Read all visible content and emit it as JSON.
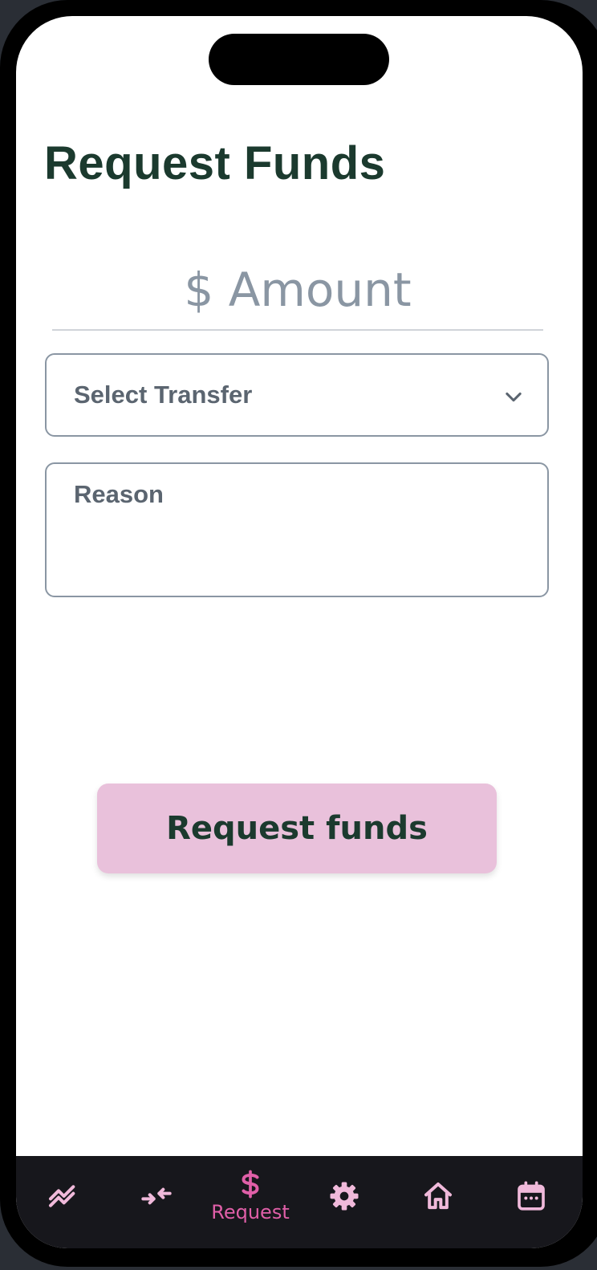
{
  "page": {
    "title": "Request Funds"
  },
  "form": {
    "amount_placeholder": "$ Amount",
    "amount_value": "",
    "transfer_select_label": "Select Transfer",
    "reason_placeholder": "Reason",
    "reason_value": "",
    "submit_label": "Request funds"
  },
  "nav": {
    "items": [
      {
        "icon": "trending-up-icon",
        "label": "",
        "active": false
      },
      {
        "icon": "transfer-arrows-icon",
        "label": "",
        "active": false
      },
      {
        "icon": "dollar-icon",
        "label": "Request",
        "active": true
      },
      {
        "icon": "gear-icon",
        "label": "",
        "active": false
      },
      {
        "icon": "home-icon",
        "label": "",
        "active": false
      },
      {
        "icon": "calendar-icon",
        "label": "",
        "active": false
      }
    ]
  },
  "colors": {
    "title": "#1b3a2e",
    "button_bg": "#e9c1db",
    "nav_bg": "#17171c",
    "nav_icon": "#f0b9da",
    "nav_active": "#e05fa8"
  }
}
